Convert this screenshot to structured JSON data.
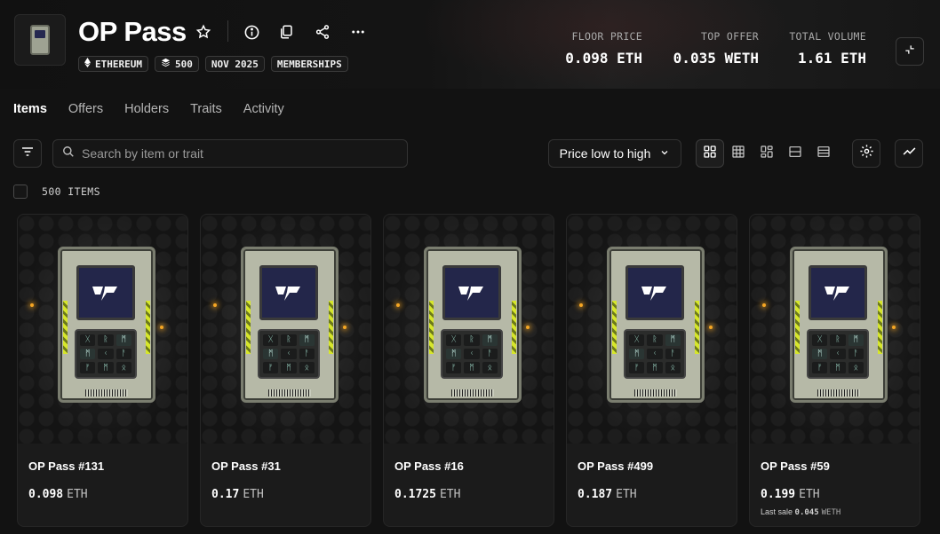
{
  "collection": {
    "title": "OP Pass",
    "badges": [
      {
        "icon": "ethereum-icon",
        "label": "ETHEREUM"
      },
      {
        "icon": "layers-icon",
        "label": "500"
      },
      {
        "icon": "",
        "label": "NOV 2025"
      },
      {
        "icon": "",
        "label": "MEMBERSHIPS"
      }
    ]
  },
  "stats": [
    {
      "label": "FLOOR PRICE",
      "value": "0.098 ETH"
    },
    {
      "label": "TOP OFFER",
      "value": "0.035 WETH"
    },
    {
      "label": "TOTAL VOLUME",
      "value": "1.61 ETH"
    }
  ],
  "tabs": [
    {
      "label": "Items",
      "active": true
    },
    {
      "label": "Offers",
      "active": false
    },
    {
      "label": "Holders",
      "active": false
    },
    {
      "label": "Traits",
      "active": false
    },
    {
      "label": "Activity",
      "active": false
    }
  ],
  "toolbar": {
    "search_placeholder": "Search by item or trait",
    "sort_label": "Price low to high"
  },
  "items_count": "500 ITEMS",
  "cards": [
    {
      "name": "OP Pass #131",
      "price": "0.098",
      "unit": "ETH"
    },
    {
      "name": "OP Pass #31",
      "price": "0.17",
      "unit": "ETH"
    },
    {
      "name": "OP Pass #16",
      "price": "0.1725",
      "unit": "ETH"
    },
    {
      "name": "OP Pass #499",
      "price": "0.187",
      "unit": "ETH"
    },
    {
      "name": "OP Pass #59",
      "price": "0.199",
      "unit": "ETH",
      "last_sale_label": "Last sale",
      "last_sale_price": "0.045",
      "last_sale_unit": "WETH"
    }
  ],
  "colors": {
    "background": "#121212",
    "card": "#1b1b1b",
    "border": "#333333",
    "accent_glow": "#f5a623"
  }
}
